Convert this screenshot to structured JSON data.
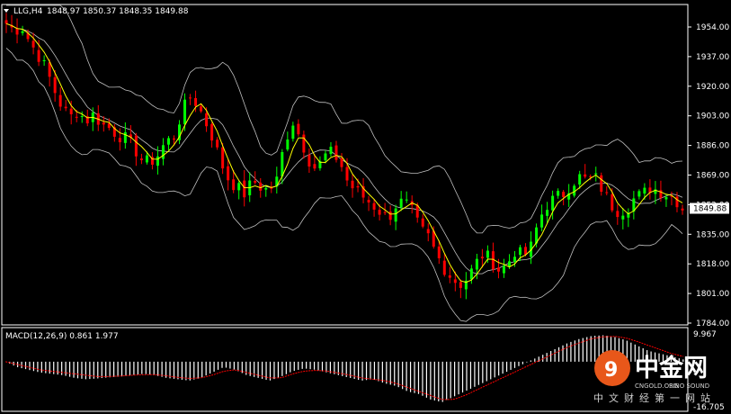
{
  "header": {
    "symbol": "LLG,H4",
    "ohlc": "1848.97 1850.37 1848.35 1849.88"
  },
  "colors": {
    "background": "#000000",
    "bull": "#00ff00",
    "bear": "#ff0000",
    "bands": "#c0c0c0",
    "ma": "#ffff00",
    "macd_hist": "#ffffff",
    "macd_signal": "#ff0000",
    "price_tag": "#ffffff"
  },
  "chart_data": [
    {
      "type": "candlestick",
      "title": "LLG,H4",
      "ylim": [
        1784,
        1962
      ],
      "y_ticks": [
        "1954.00",
        "1937.00",
        "1920.00",
        "1903.00",
        "1886.00",
        "1869.00",
        "1852.00",
        "1835.00",
        "1818.00",
        "1801.00",
        "1784.00"
      ],
      "last_price": "1849.88",
      "open": 1848.97,
      "high": 1850.37,
      "low": 1848.35,
      "close": 1849.88,
      "anchor_closes": [
        1956,
        1952,
        1954,
        1945,
        1938,
        1930,
        1918,
        1908,
        1902,
        1906,
        1900,
        1904,
        1898,
        1896,
        1892,
        1890,
        1885,
        1878,
        1876,
        1880,
        1888,
        1890,
        1904,
        1914,
        1910,
        1900,
        1890,
        1876,
        1866,
        1862,
        1858,
        1866,
        1862,
        1860,
        1866,
        1888,
        1900,
        1890,
        1878,
        1872,
        1880,
        1882,
        1876,
        1864,
        1860,
        1856,
        1852,
        1848,
        1844,
        1852,
        1854,
        1848,
        1838,
        1834,
        1824,
        1816,
        1810,
        1806,
        1810,
        1818,
        1824,
        1820,
        1814,
        1818,
        1826,
        1822,
        1828,
        1844,
        1852,
        1856,
        1858,
        1864,
        1868,
        1866,
        1868,
        1860,
        1852,
        1848,
        1850,
        1856,
        1858,
        1862,
        1860,
        1858,
        1856,
        1849.88
      ],
      "overlays": [
        "Bollinger Bands",
        "Moving Average"
      ]
    },
    {
      "type": "bar",
      "title": "MACD(12,26,9) 0.861 1.977",
      "indicator": "MACD",
      "params": "12,26,9",
      "macd_value": 0.861,
      "signal_value": 1.977,
      "ylim": [
        -16.705,
        9.967
      ],
      "y_ticks": [
        "9.967",
        "-16.705"
      ],
      "anchor_hist": [
        0,
        -2,
        -3,
        -4,
        -4.5,
        -5,
        -6,
        -6.5,
        -6.2,
        -5.8,
        -5.5,
        -5,
        -4.5,
        -5,
        -6,
        -6.5,
        -7,
        -6,
        -4,
        -2,
        -3,
        -5,
        -6,
        -7,
        -5.5,
        -3.5,
        -2.5,
        -3,
        -4,
        -5,
        -6,
        -7,
        -6.5,
        -8,
        -9,
        -11,
        -12,
        -14,
        -15,
        -13,
        -11,
        -9,
        -7,
        -5,
        -3,
        -1,
        1,
        3,
        5,
        7,
        8.5,
        9.5,
        9.8,
        9.2,
        8,
        6,
        4,
        3,
        2,
        0.861
      ],
      "anchor_signal": [
        0,
        -1,
        -2,
        -3,
        -3.5,
        -4,
        -4.5,
        -5,
        -5.5,
        -5.5,
        -5.3,
        -5,
        -4.8,
        -4.8,
        -5.2,
        -5.8,
        -6.2,
        -6,
        -5,
        -3.5,
        -3,
        -4,
        -5,
        -6,
        -6,
        -4.5,
        -3.5,
        -3.2,
        -3.5,
        -4.2,
        -5,
        -6,
        -6.5,
        -7,
        -8,
        -9.5,
        -11,
        -12.5,
        -14,
        -14,
        -12.5,
        -10.5,
        -8.5,
        -6.5,
        -4.5,
        -2.5,
        -0.5,
        1.5,
        3.5,
        5.5,
        7,
        8.5,
        9.2,
        9.4,
        8.8,
        7.5,
        6,
        4.5,
        3,
        1.977
      ]
    }
  ],
  "watermark": {
    "brand": "中金网",
    "site": "CNGOLD.ORG",
    "small": "SINO SOUND",
    "tagline": "中文财经第一网站"
  }
}
